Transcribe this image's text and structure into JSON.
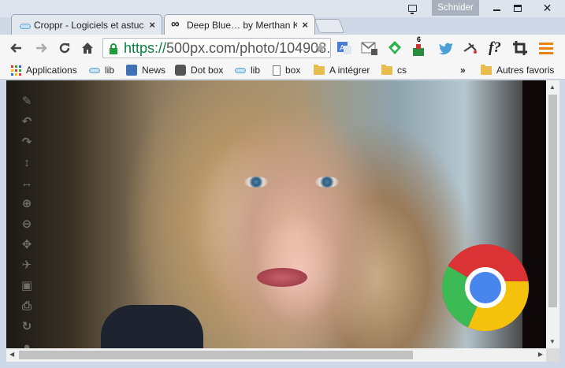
{
  "window": {
    "user_name": "Schnider",
    "controls": [
      "minimize",
      "maximize",
      "close"
    ]
  },
  "tabs": [
    {
      "title": "Croppr - Logiciels et astuces",
      "icon": "cloud-favicon-icon",
      "active": false
    },
    {
      "title": "Deep Blue… by Merthan Kara",
      "icon": "infinity-favicon-icon",
      "active": true
    }
  ],
  "toolbar": {
    "address": {
      "scheme": "https://",
      "rest": "500px.com/photo/104908..."
    },
    "extensions": [
      "translate-icon",
      "gmail-icon",
      "feedly-icon",
      "counter-icon",
      "twitter-icon",
      "pick-icon",
      "formula-icon",
      "crop-icon",
      "menu-icon"
    ],
    "counter_badge": "6",
    "formula_label": "f?"
  },
  "bookmarks": {
    "items": [
      {
        "label": "Applications",
        "icon": "apps-grid-icon"
      },
      {
        "label": "lib",
        "icon": "cloud-icon"
      },
      {
        "label": "News",
        "icon": "news-icon"
      },
      {
        "label": "Dot box",
        "icon": "feather-icon"
      },
      {
        "label": "lib",
        "icon": "cloud-icon"
      },
      {
        "label": "box",
        "icon": "page-icon"
      },
      {
        "label": "A intégrer",
        "icon": "folder-icon"
      },
      {
        "label": "cs",
        "icon": "folder-icon"
      }
    ],
    "overflow": "»",
    "other": "Autres favoris"
  },
  "side_tools": [
    "brush-icon",
    "undo-icon",
    "redo-icon",
    "vertical-resize-icon",
    "horizontal-resize-icon",
    "zoom-in-icon",
    "zoom-out-icon",
    "move-icon",
    "twitter-icon",
    "facebook-icon",
    "print-icon",
    "refresh-icon",
    "info-icon"
  ]
}
